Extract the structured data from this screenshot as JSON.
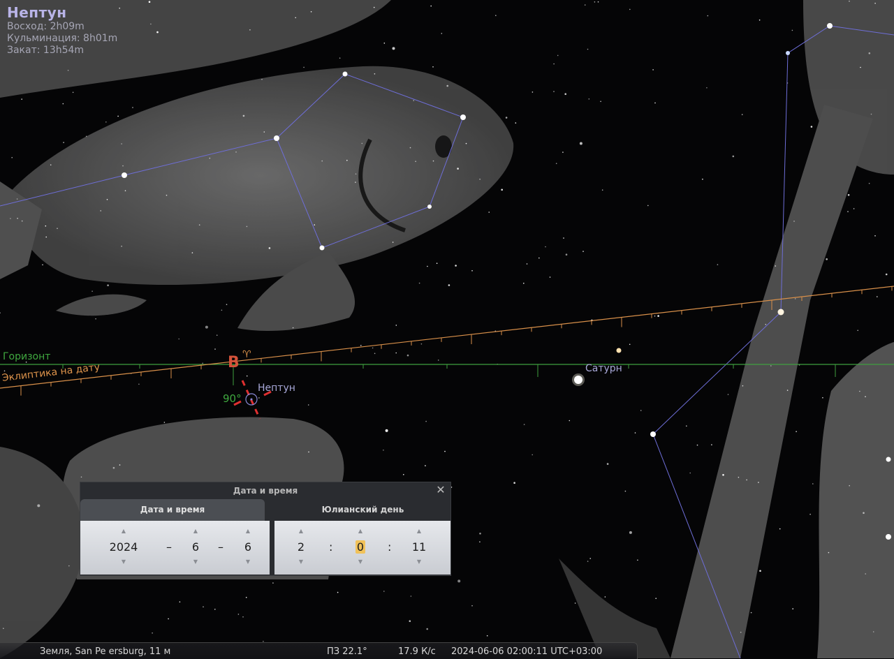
{
  "object_info": {
    "name": "Нептун",
    "rise": "Восход: 2h09m",
    "transit": "Кульминация: 8h01m",
    "set": "Закат: 13h54m"
  },
  "sky_labels": {
    "horizon": "Горизонт",
    "ecliptic": "Эклиптика на дату",
    "east": "В",
    "aries": "♈",
    "azimuth": "90°",
    "neptune": "Нептун",
    "saturn": "Сатурн"
  },
  "colors": {
    "horizon": "#3f9f3f",
    "ecliptic": "#d9904a",
    "constellation_lines": "#6e6ed8",
    "cardinal": "#d4523a",
    "status_text": "#d8d8d8"
  },
  "dialog": {
    "title": "Дата и время",
    "close_icon": "close-icon",
    "tabs": [
      "Дата и время",
      "Юлианский день"
    ],
    "active_tab": 0,
    "date": {
      "year": "2024",
      "month": "6",
      "day": "6",
      "sep": "–"
    },
    "time": {
      "hour": "2",
      "minute": "0",
      "second": "11",
      "sep": ":"
    }
  },
  "status_bar": {
    "location": "Земля, San  Pe ersburg, 11 м",
    "fov": "ПЗ 22.1°",
    "fps": "17.9 К/с",
    "datetime": "2024-06-06 02:00:11 UTC+03:00"
  }
}
